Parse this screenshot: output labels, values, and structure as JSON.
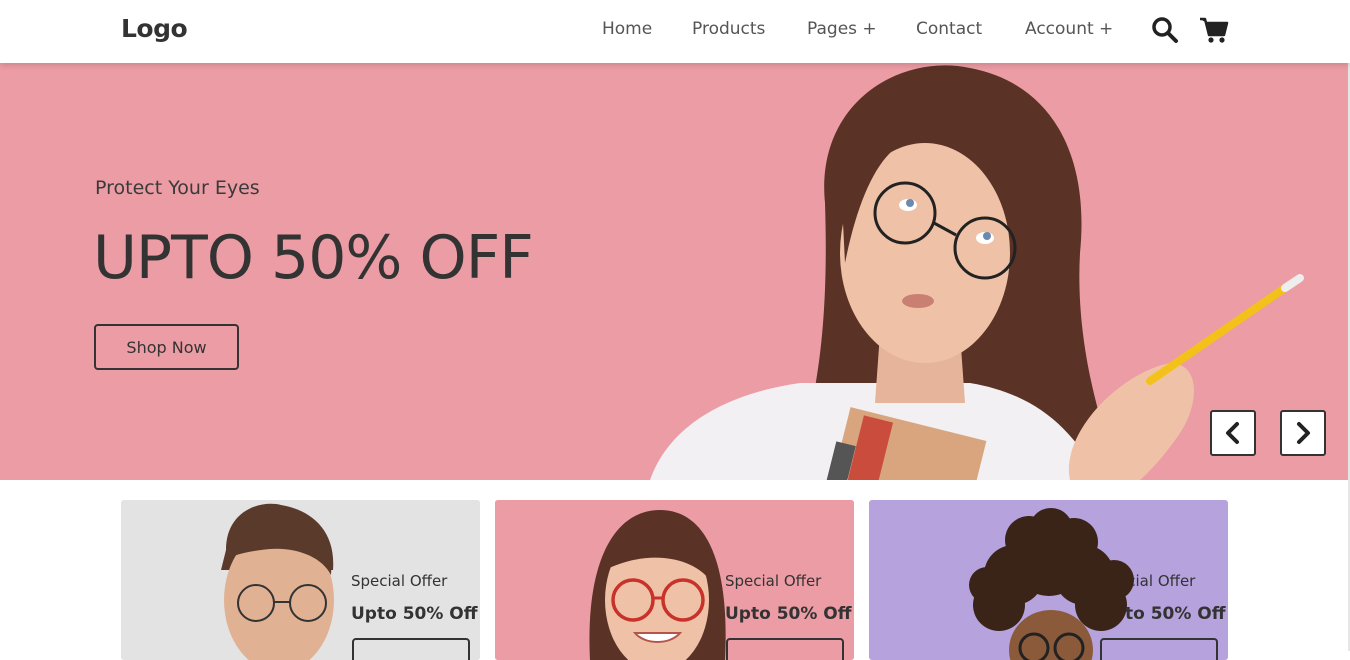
{
  "navbar": {
    "logo": "Logo",
    "links": [
      "Home",
      "Products",
      "Pages +",
      "Contact",
      "Account +"
    ],
    "icons": [
      "search-icon",
      "cart-icon"
    ]
  },
  "hero": {
    "subtitle": "Protect Your Eyes",
    "title": "UPTO 50% OFF",
    "button": "Shop Now",
    "background": "#ec9ca4",
    "arrows": [
      "chevron-left-icon",
      "chevron-right-icon"
    ]
  },
  "cards": [
    {
      "subtitle": "Special Offer",
      "title": "Upto 50% Off",
      "background": "#e3e3e3"
    },
    {
      "subtitle": "Special Offer",
      "title": "Upto 50% Off",
      "background": "#ec9ca4"
    },
    {
      "subtitle": "Special Offer",
      "title": "Upto 50% Off",
      "background": "#b6a2dc"
    }
  ]
}
